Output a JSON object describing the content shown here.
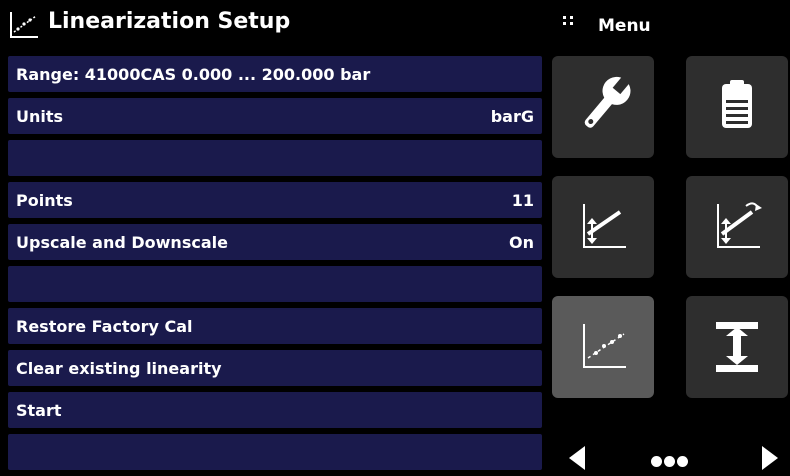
{
  "header": {
    "title": "Linearization Setup",
    "menu_label": "Menu"
  },
  "list": {
    "rows": [
      {
        "label": "Range: 41000CAS   0.000 ... 200.000 bar",
        "value": ""
      },
      {
        "label": "Units",
        "value": "barG"
      },
      {
        "label": "",
        "value": ""
      },
      {
        "label": "Points",
        "value": "11"
      },
      {
        "label": "Upscale and Downscale",
        "value": "On"
      },
      {
        "label": "",
        "value": ""
      },
      {
        "label": "Restore Factory Cal",
        "value": ""
      },
      {
        "label": "Clear existing linearity",
        "value": ""
      },
      {
        "label": "Start",
        "value": ""
      },
      {
        "label": "",
        "value": ""
      }
    ]
  },
  "menu": {
    "tiles": [
      {
        "icon": "wrench-icon"
      },
      {
        "icon": "notepad-icon"
      },
      {
        "icon": "zero-adjust-chart-icon"
      },
      {
        "icon": "span-adjust-chart-icon"
      },
      {
        "icon": "linearization-chart-icon",
        "active": true
      },
      {
        "icon": "height-correction-icon"
      }
    ]
  },
  "pager": {
    "prev_icon": "left-arrow-icon",
    "next_icon": "right-arrow-icon",
    "dots_icon": "page-dots-icon"
  },
  "colors": {
    "row_bg": "#1a1a4c",
    "tile_bg": "#2e2e2e",
    "tile_active_bg": "#5a5a5a",
    "background": "#000000"
  }
}
